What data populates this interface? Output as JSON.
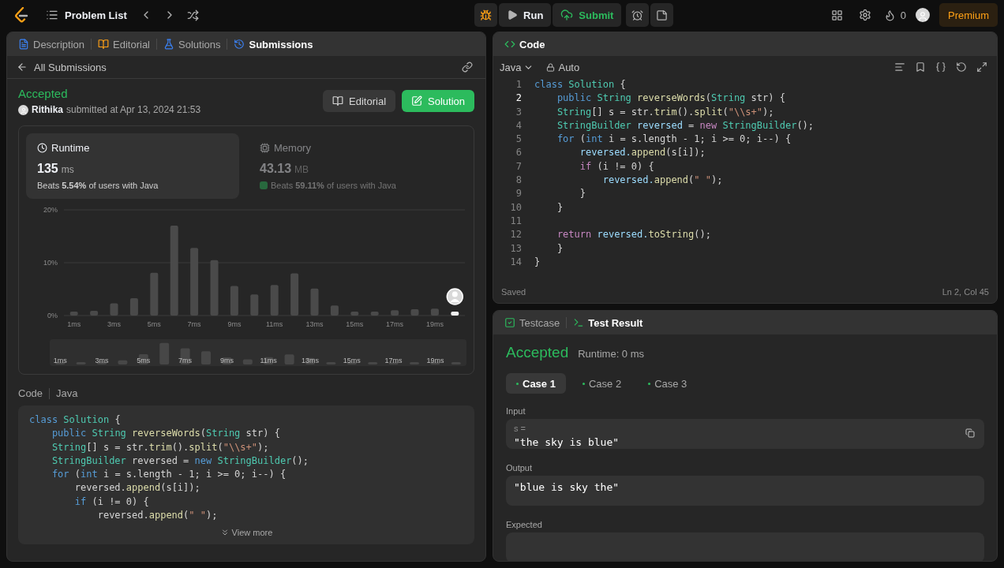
{
  "topbar": {
    "problem_list": "Problem List",
    "run": "Run",
    "submit": "Submit",
    "streak": "0",
    "premium": "Premium"
  },
  "left_tabs": [
    {
      "label": "Description",
      "kind": "description",
      "selected": false
    },
    {
      "label": "Editorial",
      "kind": "editorial",
      "selected": false
    },
    {
      "label": "Solutions",
      "kind": "solutions",
      "selected": false
    },
    {
      "label": "Submissions",
      "kind": "submissions",
      "selected": true
    }
  ],
  "back_link": "All Submissions",
  "submission": {
    "status": "Accepted",
    "author": "Rithika",
    "submitted": "submitted at Apr 13, 2024 21:53",
    "buttons": [
      {
        "label": "Editorial",
        "kind": "editorial"
      },
      {
        "label": "Solution",
        "kind": "solution"
      }
    ]
  },
  "stats": [
    {
      "kind": "runtime",
      "title": "Runtime",
      "value": "135",
      "unit": "ms",
      "beats": "Beats **5.54%** of users with Java",
      "selected": true
    },
    {
      "kind": "memory",
      "title": "Memory",
      "value": "43.13",
      "unit": "MB",
      "beats": "Beats **59.11%** of users with Java",
      "selected": false
    }
  ],
  "chart_data": {
    "type": "bar",
    "x": [
      1,
      2,
      3,
      4,
      5,
      6,
      7,
      8,
      9,
      10,
      11,
      12,
      13,
      14,
      15,
      16,
      17,
      18,
      19,
      20
    ],
    "xlim": [
      0.5,
      20.5
    ],
    "series": [
      {
        "color": "#4a4a4a",
        "values": [
          0.6,
          0.9,
          2.3,
          3.3,
          8.1,
          17.0,
          12.8,
          10.5,
          5.6,
          4.0,
          5.8,
          8.0,
          5.1,
          1.9,
          0.7,
          0.7,
          1.0,
          1.2,
          1.3,
          null
        ]
      },
      {
        "color": "#f2f2f2",
        "values": [
          null,
          null,
          null,
          null,
          null,
          null,
          null,
          null,
          null,
          null,
          null,
          null,
          null,
          null,
          null,
          null,
          null,
          null,
          null,
          0.6
        ]
      }
    ],
    "ylim": [
      0,
      20
    ],
    "yticks": [
      {
        "value": 0,
        "label": "0%"
      },
      {
        "value": 10,
        "label": "10%"
      },
      {
        "value": 20,
        "label": "20%"
      }
    ],
    "xticks": [
      {
        "value": 1,
        "label": "1ms"
      },
      {
        "value": 3,
        "label": "3ms"
      },
      {
        "value": 5,
        "label": "5ms"
      },
      {
        "value": 7,
        "label": "7ms"
      },
      {
        "value": 9,
        "label": "9ms"
      },
      {
        "value": 11,
        "label": "11ms"
      },
      {
        "value": 13,
        "label": "13ms"
      },
      {
        "value": 15,
        "label": "15ms"
      },
      {
        "value": 17,
        "label": "17ms"
      },
      {
        "value": 19,
        "label": "19ms"
      }
    ]
  },
  "overview_labels": [
    "1ms",
    "3ms",
    "5ms",
    "7ms",
    "9ms",
    "11ms",
    "13ms",
    "15ms",
    "17ms",
    "19ms"
  ],
  "code_preview": {
    "label": "Code",
    "language": "Java",
    "view_more": "View more",
    "lines": [
      [
        {
          "kind": "kw",
          "text": "class "
        },
        {
          "kind": "type",
          "text": "Solution"
        },
        {
          "kind": "p",
          "text": " {"
        }
      ],
      [
        {
          "kind": "kw",
          "text": "    public "
        },
        {
          "kind": "type",
          "text": "String "
        },
        {
          "kind": "fn",
          "text": "reverseWords"
        },
        {
          "kind": "p",
          "text": "("
        },
        {
          "kind": "type",
          "text": "String"
        },
        {
          "kind": "p",
          "text": " str) {"
        }
      ],
      [
        {
          "kind": "type",
          "text": "    String"
        },
        {
          "kind": "p",
          "text": "[] s = str."
        },
        {
          "kind": "fn",
          "text": "trim"
        },
        {
          "kind": "p",
          "text": "()."
        },
        {
          "kind": "fn",
          "text": "split"
        },
        {
          "kind": "p",
          "text": "("
        },
        {
          "kind": "str",
          "text": "\"\\\\s+\""
        },
        {
          "kind": "p",
          "text": ");"
        }
      ],
      [
        {
          "kind": "type",
          "text": "    StringBuilder"
        },
        {
          "kind": "p",
          "text": " reversed = "
        },
        {
          "kind": "kw",
          "text": "new "
        },
        {
          "kind": "type",
          "text": "StringBuilder"
        },
        {
          "kind": "p",
          "text": "();"
        }
      ],
      [
        {
          "kind": "kw",
          "text": "    for"
        },
        {
          "kind": "p",
          "text": " ("
        },
        {
          "kind": "kw",
          "text": "int"
        },
        {
          "kind": "p",
          "text": " i = s.length - 1; i >= 0; i--) {"
        }
      ],
      [
        {
          "kind": "p",
          "text": "        reversed."
        },
        {
          "kind": "fn",
          "text": "append"
        },
        {
          "kind": "p",
          "text": "(s[i]);"
        }
      ],
      [
        {
          "kind": "kw",
          "text": "        if"
        },
        {
          "kind": "p",
          "text": " (i != 0) {"
        }
      ],
      [
        {
          "kind": "p",
          "text": "            reversed."
        },
        {
          "kind": "fn",
          "text": "append"
        },
        {
          "kind": "p",
          "text": "("
        },
        {
          "kind": "str",
          "text": "\" \""
        },
        {
          "kind": "p",
          "text": ");"
        }
      ]
    ]
  },
  "editor": {
    "title": "Code",
    "language": "Java",
    "mode": "Auto",
    "status": "Saved",
    "cursor": "Ln 2, Col 45",
    "lines": [
      {
        "number": "1",
        "active": false,
        "tokens": [
          {
            "kind": "kw",
            "text": "class "
          },
          {
            "kind": "type",
            "text": "Solution"
          },
          {
            "kind": "p",
            "text": " {"
          }
        ]
      },
      {
        "number": "2",
        "active": true,
        "tokens": [
          {
            "kind": "kw",
            "text": "    public "
          },
          {
            "kind": "type",
            "text": "String "
          },
          {
            "kind": "fn",
            "text": "reverseWords"
          },
          {
            "kind": "p",
            "text": "("
          },
          {
            "kind": "type",
            "text": "String"
          },
          {
            "kind": "p",
            "text": " str) {"
          }
        ]
      },
      {
        "number": "3",
        "active": false,
        "tokens": [
          {
            "kind": "type",
            "text": "    String"
          },
          {
            "kind": "p",
            "text": "[] s = str."
          },
          {
            "kind": "fn",
            "text": "trim"
          },
          {
            "kind": "p",
            "text": "()."
          },
          {
            "kind": "fn",
            "text": "split"
          },
          {
            "kind": "p",
            "text": "("
          },
          {
            "kind": "str",
            "text": "\"\\\\s+\""
          },
          {
            "kind": "p",
            "text": ");"
          }
        ]
      },
      {
        "number": "4",
        "active": false,
        "tokens": [
          {
            "kind": "type",
            "text": "    StringBuilder"
          },
          {
            "kind": "var",
            "text": " reversed"
          },
          {
            "kind": "p",
            "text": " = "
          },
          {
            "kind": "ctl",
            "text": "new "
          },
          {
            "kind": "type",
            "text": "StringBuilder"
          },
          {
            "kind": "p",
            "text": "();"
          }
        ]
      },
      {
        "number": "5",
        "active": false,
        "tokens": [
          {
            "kind": "kw",
            "text": "    for"
          },
          {
            "kind": "p",
            "text": " ("
          },
          {
            "kind": "kw",
            "text": "int"
          },
          {
            "kind": "p",
            "text": " i = s.length - 1; i >= 0; i--) {"
          }
        ]
      },
      {
        "number": "6",
        "active": false,
        "tokens": [
          {
            "kind": "var",
            "text": "        reversed."
          },
          {
            "kind": "fn",
            "text": "append"
          },
          {
            "kind": "p",
            "text": "(s[i]);"
          }
        ]
      },
      {
        "number": "7",
        "active": false,
        "tokens": [
          {
            "kind": "ctl",
            "text": "        if"
          },
          {
            "kind": "p",
            "text": " (i != 0) {"
          }
        ]
      },
      {
        "number": "8",
        "active": false,
        "tokens": [
          {
            "kind": "var",
            "text": "            reversed."
          },
          {
            "kind": "fn",
            "text": "append"
          },
          {
            "kind": "p",
            "text": "("
          },
          {
            "kind": "str",
            "text": "\" \""
          },
          {
            "kind": "p",
            "text": ");"
          }
        ]
      },
      {
        "number": "9",
        "active": false,
        "tokens": [
          {
            "kind": "p",
            "text": "        }"
          }
        ]
      },
      {
        "number": "10",
        "active": false,
        "tokens": [
          {
            "kind": "p",
            "text": "    }"
          }
        ]
      },
      {
        "number": "11",
        "active": false
      },
      {
        "number": "12",
        "active": false,
        "tokens": [
          {
            "kind": "ctl",
            "text": "    return"
          },
          {
            "kind": "var",
            "text": " reversed."
          },
          {
            "kind": "fn",
            "text": "toString"
          },
          {
            "kind": "p",
            "text": "();"
          }
        ]
      },
      {
        "number": "13",
        "active": false,
        "tokens": [
          {
            "kind": "p",
            "text": "    }"
          }
        ]
      },
      {
        "number": "14",
        "active": false,
        "tokens": [
          {
            "kind": "p",
            "text": "}"
          }
        ]
      }
    ]
  },
  "bottom_tabs": [
    {
      "label": "Testcase",
      "kind": "testcase",
      "selected": false
    },
    {
      "label": "Test Result",
      "kind": "result",
      "selected": true
    }
  ],
  "result": {
    "status": "Accepted",
    "runtime": "Runtime: 0 ms",
    "cases": [
      {
        "label": "Case 1",
        "selected": true
      },
      {
        "label": "Case 2",
        "selected": false
      },
      {
        "label": "Case 3",
        "selected": false
      }
    ],
    "sections": [
      {
        "label": "Input",
        "var": "s =",
        "value": "\"the sky is blue\""
      },
      {
        "label": "Output",
        "value": "\"blue is sky the\""
      },
      {
        "label": "Expected"
      }
    ]
  }
}
